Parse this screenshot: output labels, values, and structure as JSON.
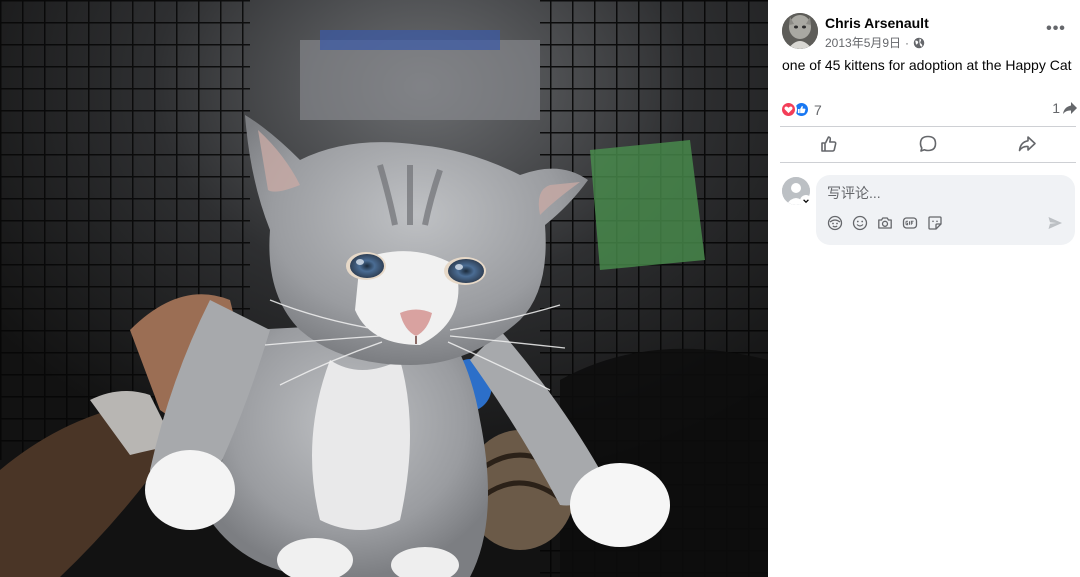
{
  "post": {
    "author": "Chris Arsenault",
    "date": "2013年5月9日",
    "separator": "·",
    "more": "•••",
    "caption": "one of 45 kittens for adoption at the Happy Cat"
  },
  "stats": {
    "reaction_count": "7",
    "share_count": "1"
  },
  "icons": {
    "privacy": "globe-icon",
    "love": "love-reaction-icon",
    "like": "like-reaction-icon",
    "share": "share-arrow-icon",
    "actions": [
      "like-icon",
      "comment-icon",
      "share-icon"
    ],
    "comment_tools": [
      "avatar-sticker-icon",
      "emoji-icon",
      "camera-icon",
      "gif-icon",
      "sticker-icon"
    ],
    "send": "send-icon"
  },
  "composer": {
    "placeholder": "写评论..."
  },
  "colors": {
    "like_blue": "#1877f2",
    "love_red": "#f33e58",
    "secondary_text": "#65676b",
    "divider": "#ced0d4",
    "input_bg": "#f0f2f5"
  }
}
